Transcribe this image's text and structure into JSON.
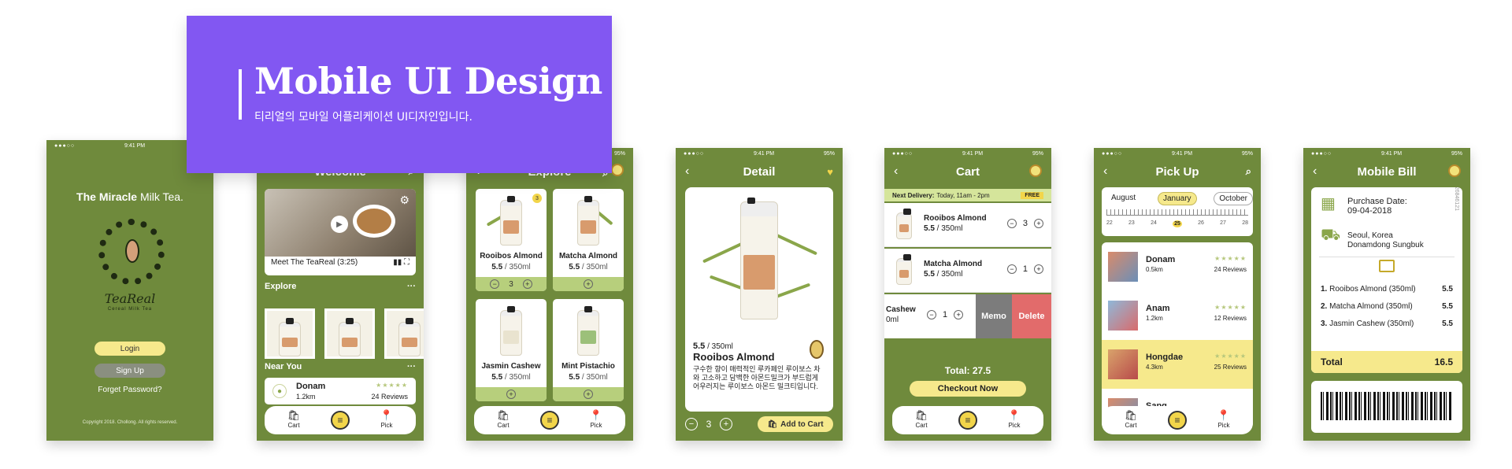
{
  "banner": {
    "title": "Mobile UI Design",
    "subtitle": "티리얼의 모바일 어플리케이션 UI디자인입니다."
  },
  "status": {
    "time": "9:41 PM",
    "battery": "95%"
  },
  "login": {
    "brand_bold": "The Miracle",
    "brand_rest": " Milk Tea.",
    "logo_text": "TeaReal",
    "logo_sub": "Cereal Milk Tea",
    "login_label": "Login",
    "signup_label": "Sign Up",
    "forget_label": "Forget Password?",
    "copyright": "Copyright 2018. Chollong. All rights reserved."
  },
  "welcome": {
    "title": "Welcome",
    "video_caption": "Meet The TeaReal (3:25)",
    "explore_label": "Explore",
    "more": "···",
    "near_label": "Near You",
    "near": {
      "name": "Donam",
      "distance": "1.2km",
      "reviews": "24 Reviews"
    }
  },
  "tabbar": {
    "cart": "Cart",
    "pick": "Pick"
  },
  "explore": {
    "title": "Explore",
    "badge": "3",
    "products": [
      {
        "name": "Rooibos Almond",
        "price": "5.5",
        "unit": " / 350ml",
        "qty": "3"
      },
      {
        "name": "Matcha Almond",
        "price": "5.5",
        "unit": " / 350ml"
      },
      {
        "name": "Jasmin Cashew",
        "price": "5.5",
        "unit": " / 350ml"
      },
      {
        "name": "Mint Pistachio",
        "price": "5.5",
        "unit": " / 350ml"
      }
    ]
  },
  "detail": {
    "title": "Detail",
    "price": "5.5",
    "unit": " / 350ml",
    "name": "Rooibos Almond",
    "description": "구수한 향이 매력적인 루카페인 루이보스 차와 고소하고 담백한 아몬드밀크가 부드럽게 어우러지는 루이보스 아몬드 밀크티입니다.",
    "qty": "3",
    "add_to_cart": "Add to Cart"
  },
  "cart": {
    "title": "Cart",
    "delivery_label": "Next Delivery:",
    "delivery_time": "Today, 11am - 2pm",
    "free": "FREE",
    "items": [
      {
        "name": "Rooibos Almond",
        "price": "5.5",
        "unit": " / 350ml",
        "qty": "3"
      },
      {
        "name": "Matcha Almond",
        "price": "5.5",
        "unit": " / 350ml",
        "qty": "1"
      }
    ],
    "swiped": {
      "name": "Cashew",
      "unit": "0ml",
      "qty": "1"
    },
    "memo": "Memo",
    "delete": "Delete",
    "total": "Total: 27.5",
    "checkout": "Checkout Now"
  },
  "pickup": {
    "title": "Pick Up",
    "months": [
      "August",
      "January",
      "October"
    ],
    "days": [
      "22",
      "23",
      "24",
      "25",
      "26",
      "27",
      "28"
    ],
    "shops": [
      {
        "name": "Donam",
        "distance": "0.5km",
        "reviews": "24 Reviews"
      },
      {
        "name": "Anam",
        "distance": "1.2km",
        "reviews": "12 Reviews"
      },
      {
        "name": "Hongdae",
        "distance": "4.3km",
        "reviews": "25 Reviews"
      },
      {
        "name": "Sang"
      }
    ]
  },
  "bill": {
    "title": "Mobile Bill",
    "purchase_label": "Purchase Date:",
    "purchase_date": "09-04-2018",
    "address_line1": "Seoul, Korea",
    "address_line2": "Donamdong Sungbuk",
    "bill_no": "26846121",
    "items": [
      {
        "no": "1.",
        "name": "Rooibos Almond (350ml)",
        "price": "5.5"
      },
      {
        "no": "2.",
        "name": "Matcha Almond (350ml)",
        "price": "5.5"
      },
      {
        "no": "3.",
        "name": "Jasmin Cashew (350ml)",
        "price": "5.5"
      }
    ],
    "total_label": "Total",
    "total_value": "16.5"
  },
  "colors": {
    "phone_bg": "#6f8a3c",
    "banner": "#8257f2",
    "accent_yellow": "#f6e98c"
  }
}
